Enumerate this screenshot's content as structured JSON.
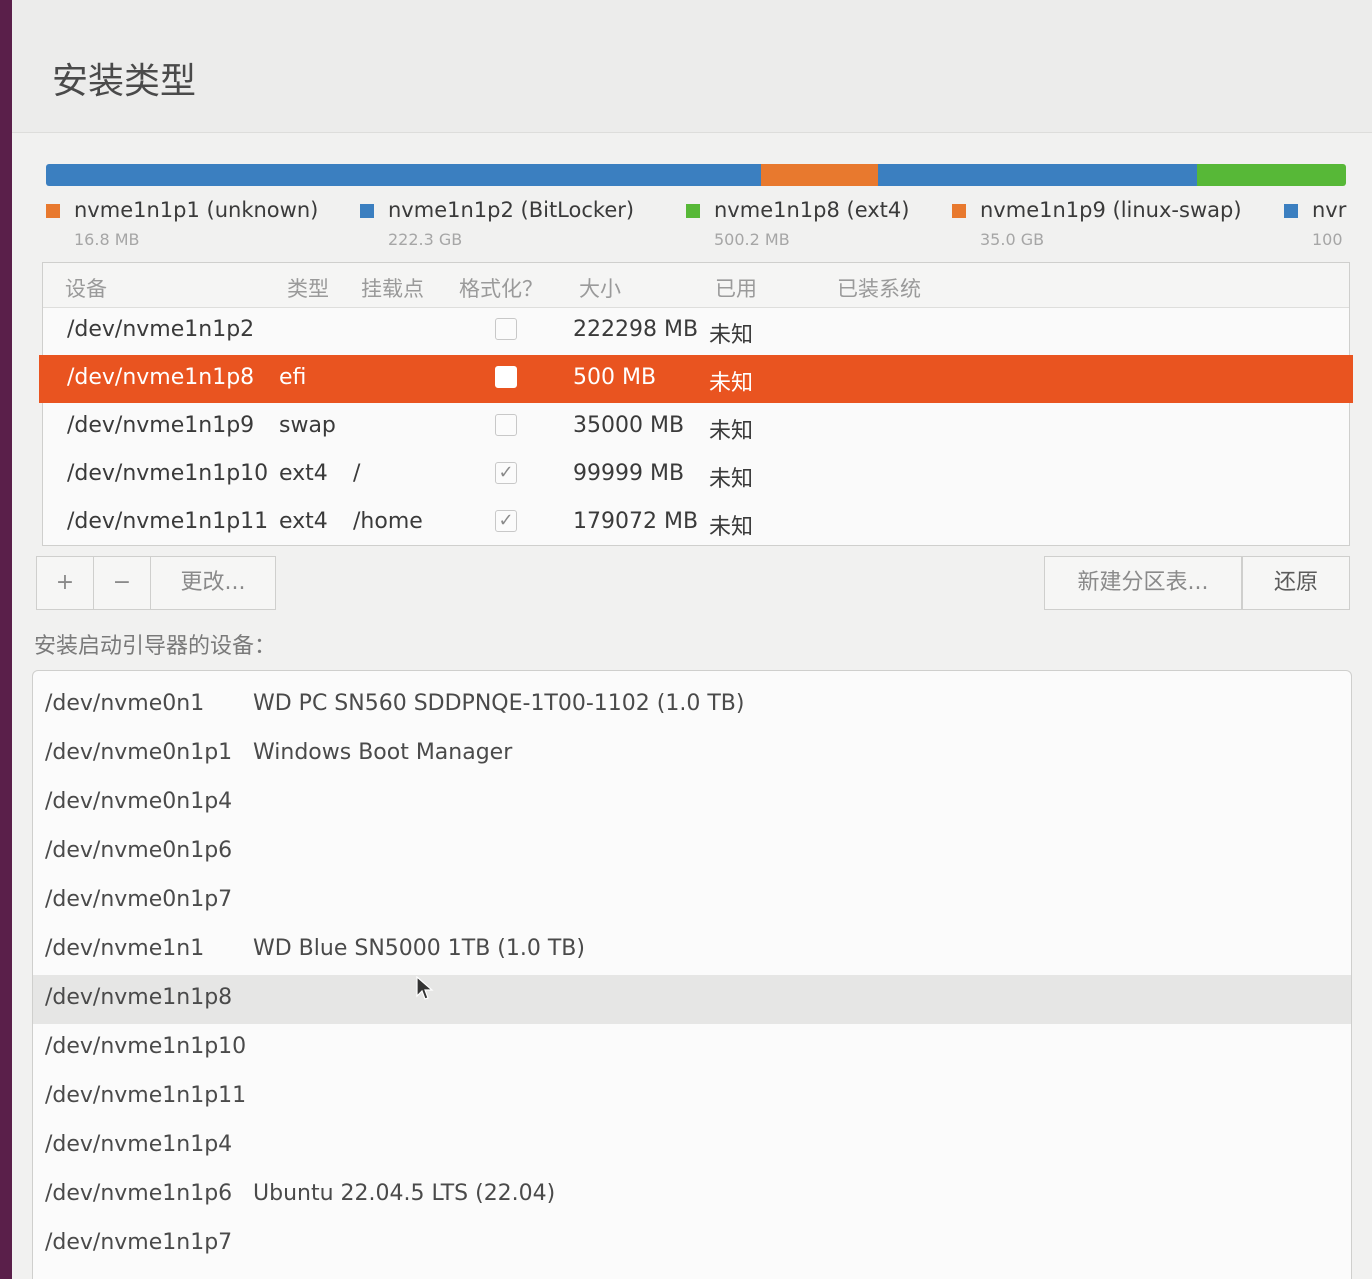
{
  "window": {
    "title": "安装类型"
  },
  "disk_bar": {
    "segments": [
      {
        "color": "#3b7fc0",
        "fraction": 0.55
      },
      {
        "color": "#e8792e",
        "fraction": 0.09
      },
      {
        "color": "#3b7fc0",
        "fraction": 0.245
      },
      {
        "color": "#57b837",
        "fraction": 0.115
      }
    ]
  },
  "legend": [
    {
      "name": "nvme1n1p1 (unknown)",
      "size": "16.8 MB",
      "color": "#e8792e"
    },
    {
      "name": "nvme1n1p2 (BitLocker)",
      "size": "222.3 GB",
      "color": "#3b7fc0"
    },
    {
      "name": "nvme1n1p8 (ext4)",
      "size": "500.2 MB",
      "color": "#57b837"
    },
    {
      "name": "nvme1n1p9 (linux-swap)",
      "size": "35.0 GB",
      "color": "#e8792e"
    },
    {
      "name": "nvr",
      "size": "100",
      "color": "#3b7fc0"
    }
  ],
  "partition_table": {
    "headers": {
      "device": "设备",
      "type": "类型",
      "mount": "挂载点",
      "format": "格式化？",
      "size": "大小",
      "used": "已用",
      "system": "已装系统"
    },
    "rows": [
      {
        "device": "/dev/nvme1n1p2",
        "type": "",
        "mount": "",
        "format": "",
        "size": "222298 MB",
        "used": "未知",
        "system": ""
      },
      {
        "device": "/dev/nvme1n1p8",
        "type": "efi",
        "mount": "",
        "format": "",
        "size": "500 MB",
        "used": "未知",
        "system": ""
      },
      {
        "device": "/dev/nvme1n1p9",
        "type": "swap",
        "mount": "",
        "format": "",
        "size": "35000 MB",
        "used": "未知",
        "system": ""
      },
      {
        "device": "/dev/nvme1n1p10",
        "type": "ext4",
        "mount": "/",
        "format": "✓",
        "size": "99999 MB",
        "used": "未知",
        "system": ""
      },
      {
        "device": "/dev/nvme1n1p11",
        "type": "ext4",
        "mount": "/home",
        "format": "✓",
        "size": "179072 MB",
        "used": "未知",
        "system": ""
      }
    ],
    "selected_index": 1
  },
  "toolbar": {
    "add": "+",
    "remove": "−",
    "change": "更改...",
    "new_table": "新建分区表...",
    "revert": "还原"
  },
  "boot": {
    "label": "安装启动引导器的设备：",
    "items": [
      {
        "device": "/dev/nvme0n1",
        "desc": "WD PC SN560 SDDPNQE-1T00-1102 (1.0 TB)"
      },
      {
        "device": "/dev/nvme0n1p1",
        "desc": "Windows Boot Manager"
      },
      {
        "device": "/dev/nvme0n1p4",
        "desc": ""
      },
      {
        "device": "/dev/nvme0n1p6",
        "desc": ""
      },
      {
        "device": "/dev/nvme0n1p7",
        "desc": ""
      },
      {
        "device": "/dev/nvme1n1",
        "desc": "WD Blue SN5000 1TB (1.0 TB)"
      },
      {
        "device": "/dev/nvme1n1p8",
        "desc": ""
      },
      {
        "device": "/dev/nvme1n1p10",
        "desc": ""
      },
      {
        "device": "/dev/nvme1n1p11",
        "desc": ""
      },
      {
        "device": "/dev/nvme1n1p4",
        "desc": ""
      },
      {
        "device": "/dev/nvme1n1p6",
        "desc": "Ubuntu 22.04.5 LTS (22.04)"
      },
      {
        "device": "/dev/nvme1n1p7",
        "desc": ""
      }
    ],
    "hover_index": 6
  }
}
